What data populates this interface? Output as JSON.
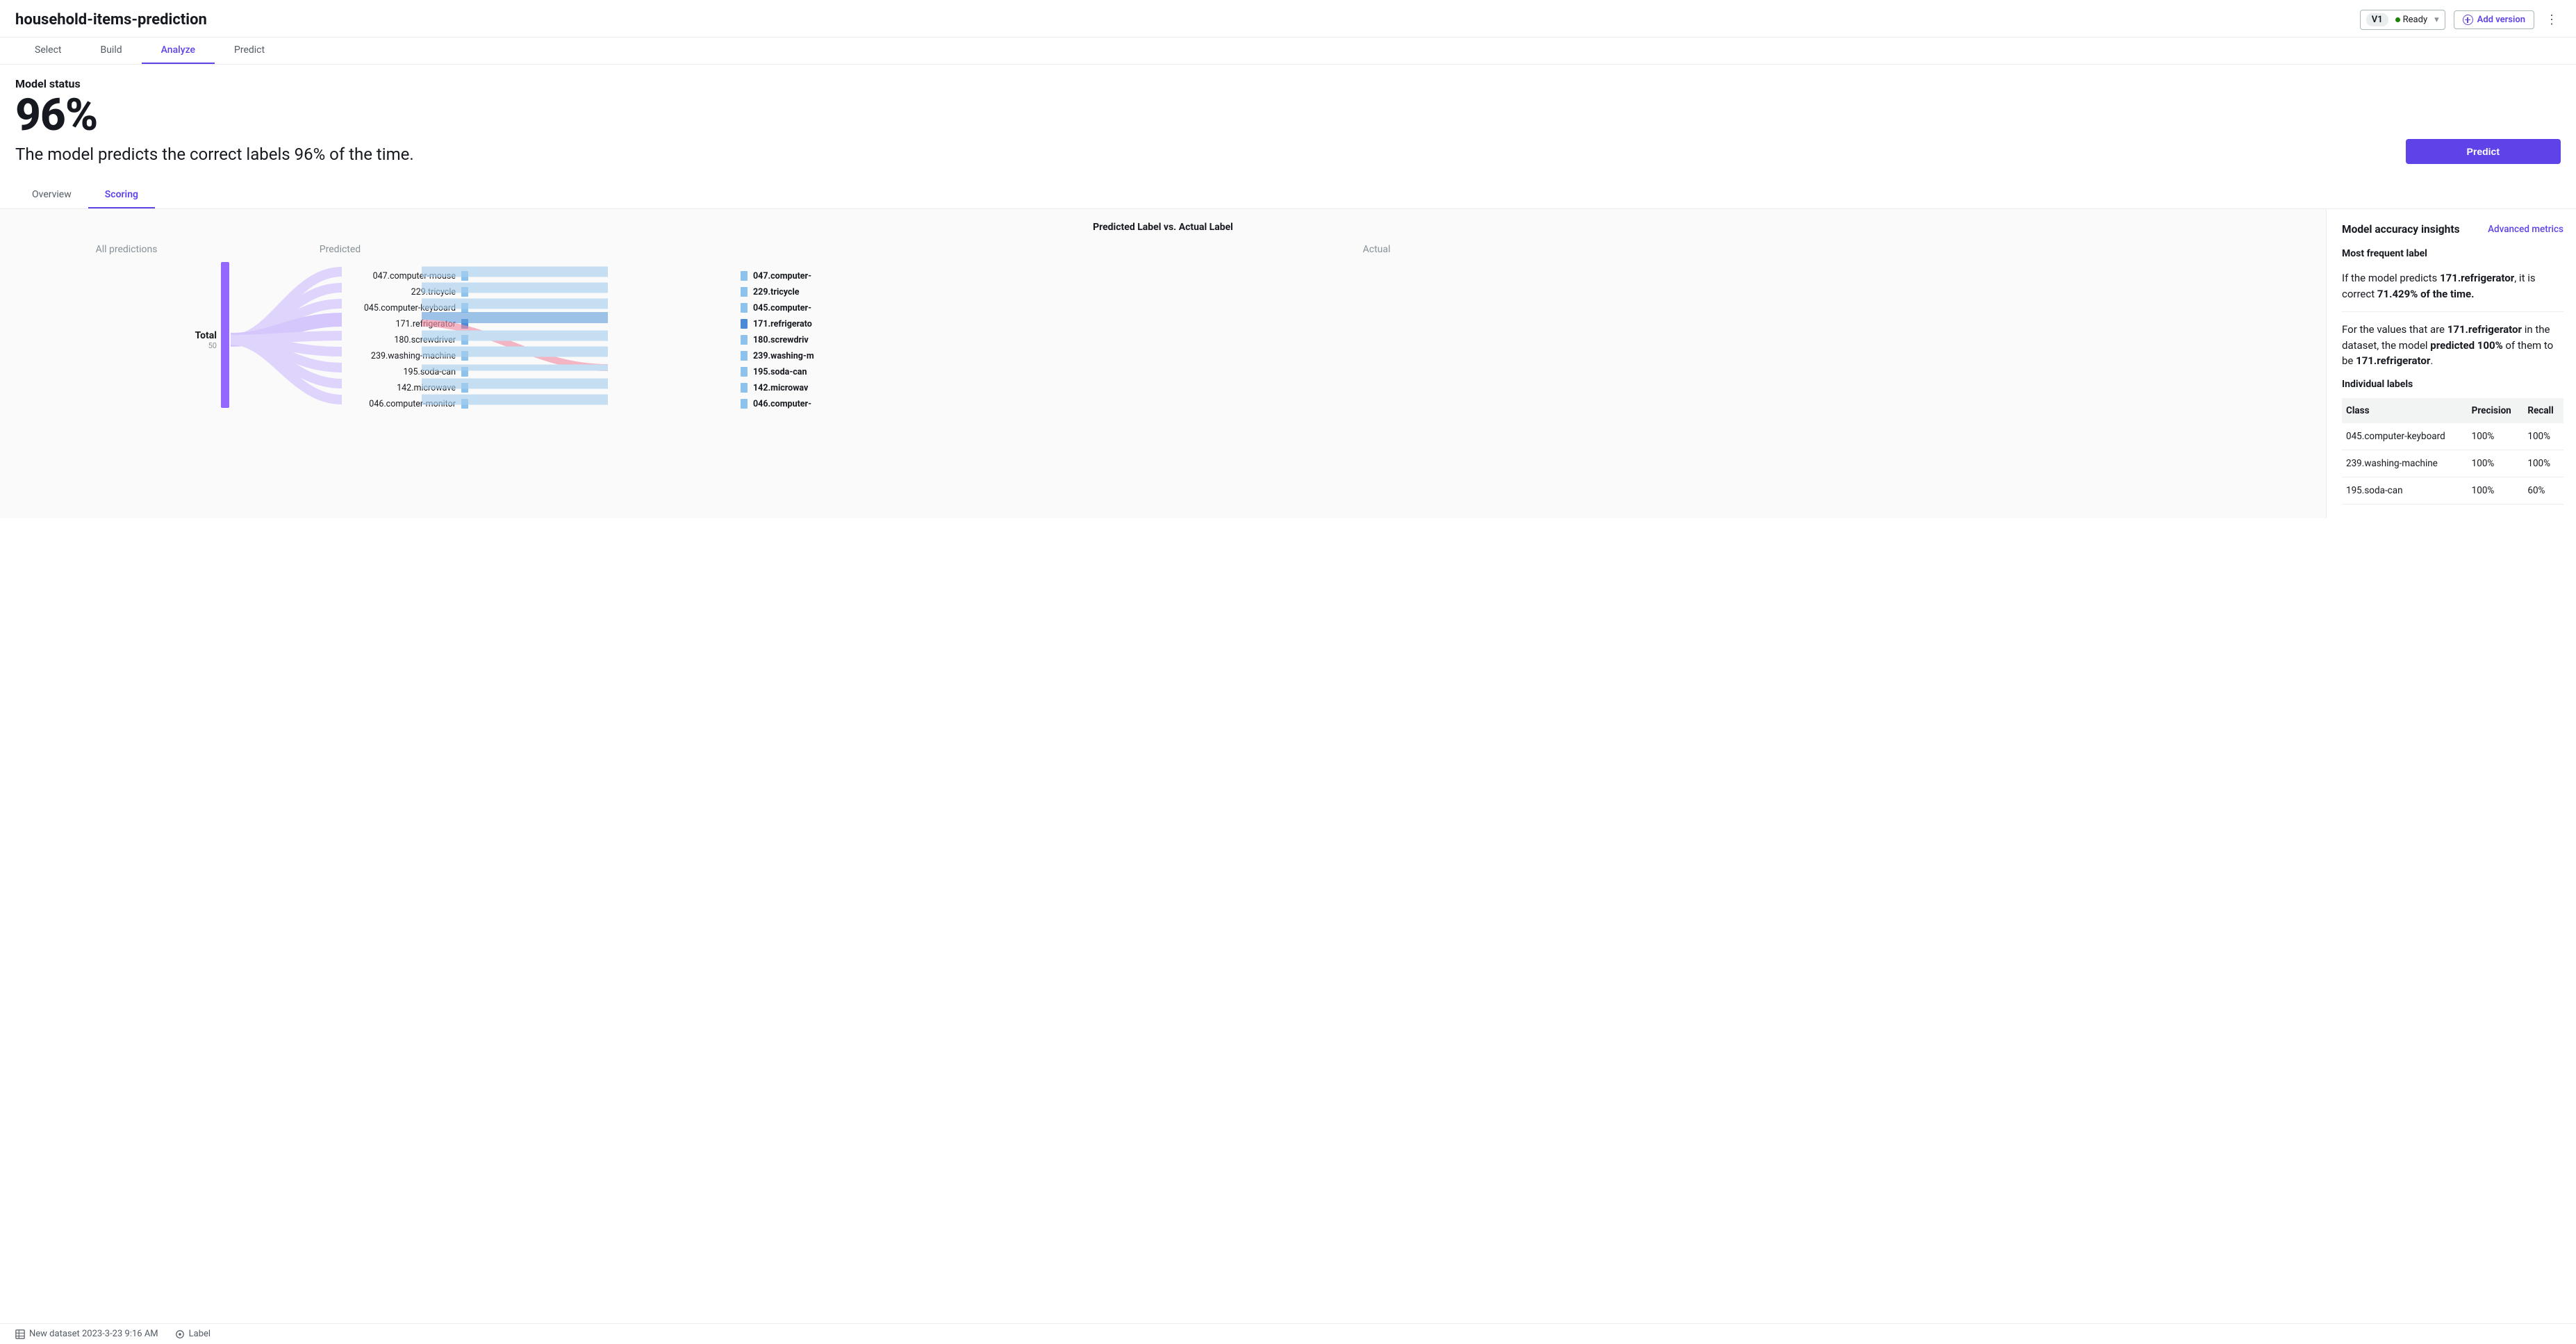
{
  "header": {
    "title": "household-items-prediction",
    "version_label": "V1",
    "status": "Ready",
    "add_version": "Add version"
  },
  "maintabs": [
    "Select",
    "Build",
    "Analyze",
    "Predict"
  ],
  "maintab_active": 2,
  "status": {
    "label": "Model status",
    "big": "96%",
    "subtitle": "The model predicts the correct labels 96% of the time.",
    "predict_btn": "Predict"
  },
  "subtabs": [
    "Overview",
    "Scoring"
  ],
  "subtab_active": 1,
  "chart_data": {
    "type": "sankey",
    "title": "Predicted Label vs. Actual Label",
    "col_headers": [
      "All predictions",
      "Predicted",
      "Actual"
    ],
    "total": {
      "label": "Total",
      "count": "50"
    },
    "predicted_labels": [
      "047.computer-mouse",
      "229.tricycle",
      "045.computer-keyboard",
      "171.refrigerator",
      "180.screwdriver",
      "239.washing-machine",
      "195.soda-can",
      "142.microwave",
      "046.computer-monitor"
    ],
    "actual_labels": [
      "047.computer-",
      "229.tricycle",
      "045.computer-",
      "171.refrigerato",
      "180.screwdriv",
      "239.washing-m",
      "195.soda-can",
      "142.microwav",
      "046.computer-"
    ],
    "highlight_index": 3,
    "misflow": {
      "from_index": 3,
      "to_index": 6
    }
  },
  "insights": {
    "heading": "Model accuracy insights",
    "advanced": "Advanced metrics",
    "mf_title": "Most frequent label",
    "p1_pre": "If the model predicts ",
    "p1_b1": "171.refrigerator",
    "p1_mid": ", it is correct ",
    "p1_b2": "71.429% of the time.",
    "p2_pre": "For the values that are ",
    "p2_b1": "171.refrigerator",
    "p2_mid": " in the dataset, the model ",
    "p2_b2": "predicted 100%",
    "p2_mid2": " of them to be ",
    "p2_b3": "171.refrigerator",
    "p2_end": ".",
    "ind_title": "Individual labels",
    "table_headers": [
      "Class",
      "Precision",
      "Recall"
    ],
    "table_rows": [
      {
        "class": "045.computer-keyboard",
        "precision": "100%",
        "recall": "100%"
      },
      {
        "class": "239.washing-machine",
        "precision": "100%",
        "recall": "100%"
      },
      {
        "class": "195.soda-can",
        "precision": "100%",
        "recall": "60%"
      }
    ]
  },
  "footer": {
    "dataset": "New dataset 2023-3-23 9:16 AM",
    "label": "Label"
  }
}
